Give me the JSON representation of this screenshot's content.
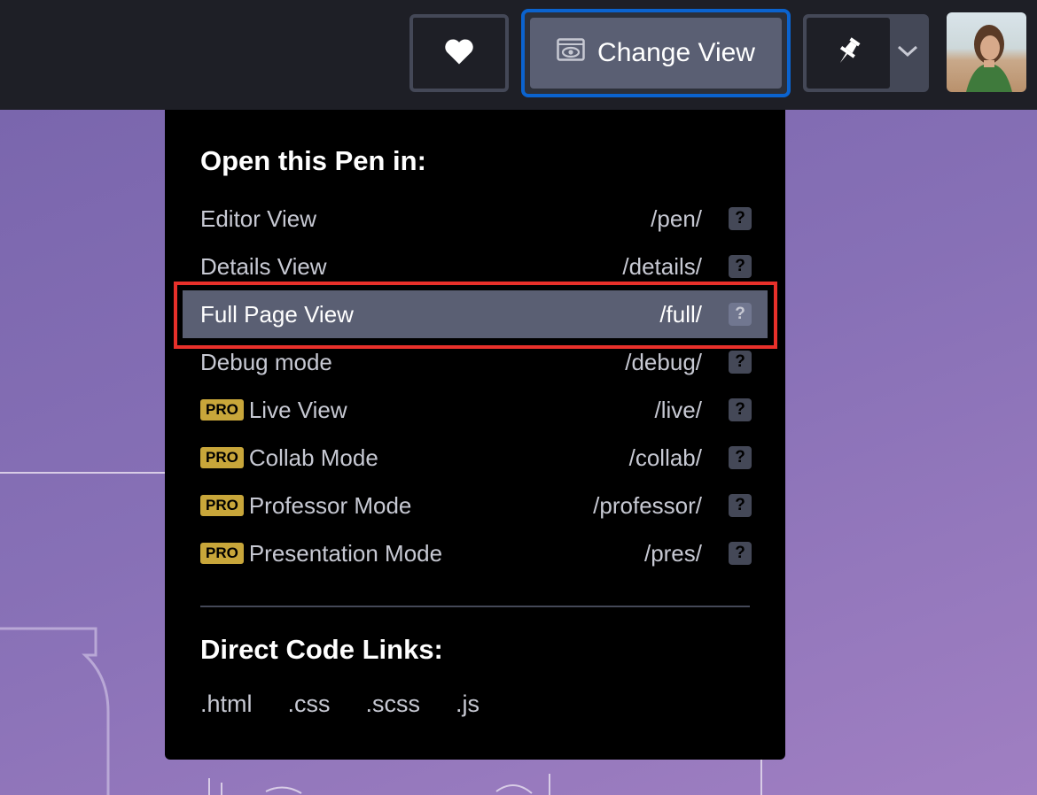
{
  "topbar": {
    "change_view_label": "Change View"
  },
  "menu": {
    "heading": "Open this Pen in:",
    "items": [
      {
        "label": "Editor View",
        "path": "/pen/",
        "pro": false,
        "help": "?"
      },
      {
        "label": "Details View",
        "path": "/details/",
        "pro": false,
        "help": "?"
      },
      {
        "label": "Full Page View",
        "path": "/full/",
        "pro": false,
        "help": "?",
        "active": true
      },
      {
        "label": "Debug mode",
        "path": "/debug/",
        "pro": false,
        "help": "?"
      },
      {
        "label": "Live View",
        "path": "/live/",
        "pro": true,
        "help": "?"
      },
      {
        "label": "Collab Mode",
        "path": "/collab/",
        "pro": true,
        "help": "?"
      },
      {
        "label": "Professor Mode",
        "path": "/professor/",
        "pro": true,
        "help": "?"
      },
      {
        "label": "Presentation Mode",
        "path": "/pres/",
        "pro": true,
        "help": "?"
      }
    ],
    "pro_badge": "PRO",
    "code_heading": "Direct Code Links:",
    "code_links": [
      ".html",
      ".css",
      ".scss",
      ".js"
    ]
  },
  "colors": {
    "accent_border": "#0b63ce",
    "highlight": "#e8302a",
    "pro_badge": "#c8a63a"
  },
  "icons": [
    "heart-icon",
    "eye-icon",
    "pin-icon",
    "chevron-down-icon"
  ]
}
